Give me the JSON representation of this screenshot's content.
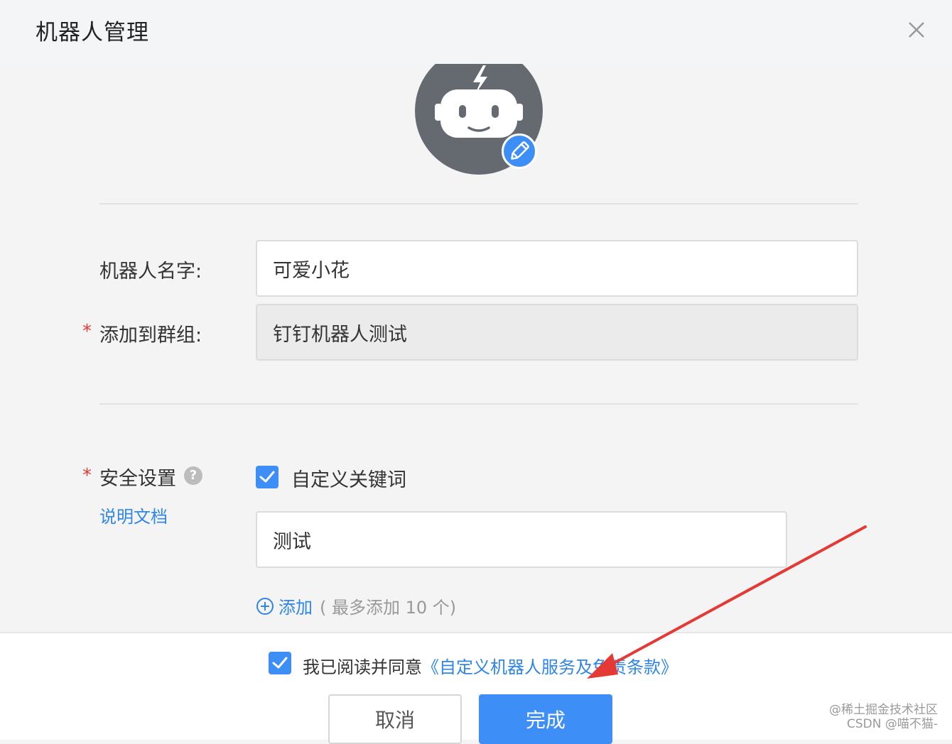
{
  "dialog": {
    "title": "机器人管理"
  },
  "form": {
    "name_label": "机器人名字:",
    "name_value": "可爱小花",
    "group_required_mark": "*",
    "group_label": "添加到群组:",
    "group_value": "钉钉机器人测试",
    "security_required_mark": "*",
    "security_label": "安全设置",
    "help_symbol": "?",
    "docs_link": "说明文档",
    "keyword_checkbox_label": "自定义关键词",
    "keyword_checked": true,
    "keyword_value": "测试",
    "add_label": "添加",
    "add_hint": "( 最多添加 10 个)"
  },
  "footer": {
    "agree_checked": true,
    "agree_text": "我已阅读并同意",
    "agree_link": "《自定义机器人服务及免责条款》",
    "cancel_label": "取消",
    "done_label": "完成"
  },
  "watermark": {
    "line1": "@稀土掘金技术社区",
    "line2": "CSDN @喵不猫-"
  },
  "colors": {
    "accent": "#3e8ef7",
    "link": "#2f86e8",
    "required": "#e53935",
    "annotation_arrow": "#e53935",
    "avatar_bg": "#656a70"
  },
  "icons": {
    "avatar": "robot-icon",
    "edit": "pencil-icon",
    "close": "close-icon",
    "help": "question-icon",
    "add": "plus-circle-icon",
    "check": "check-icon"
  }
}
